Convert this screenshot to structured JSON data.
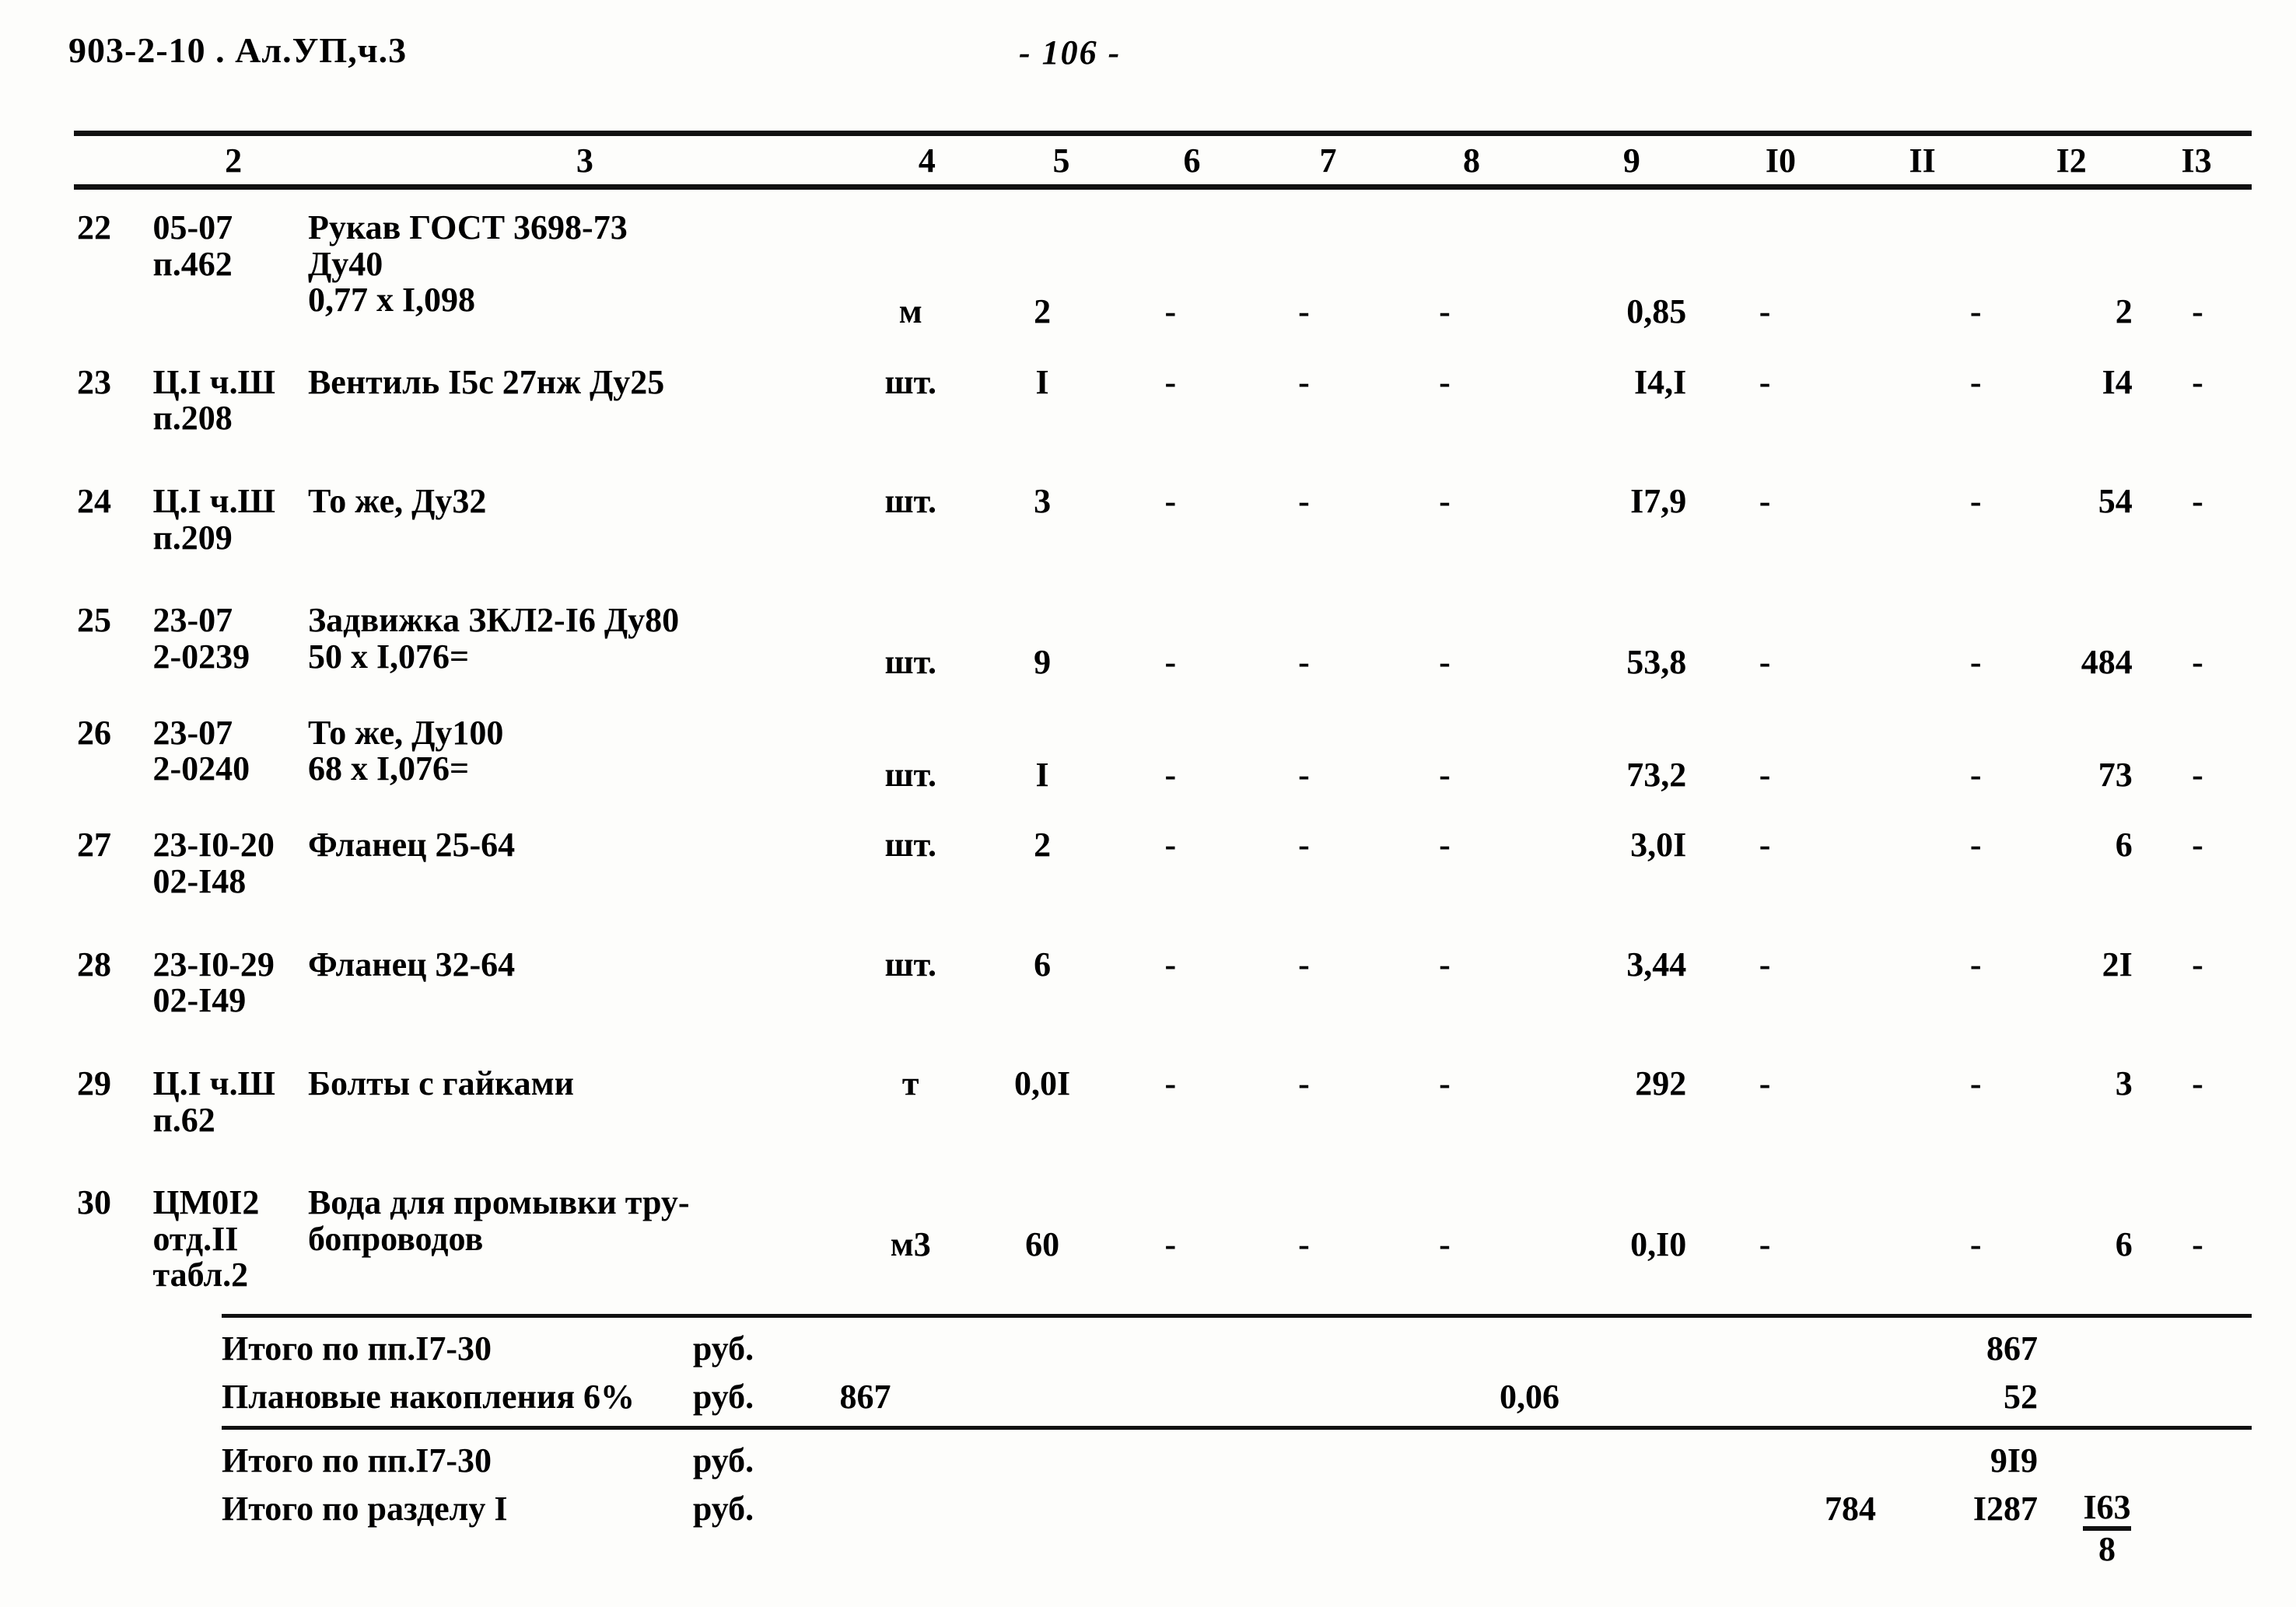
{
  "header": {
    "doc_code": "903-2-10  . Ал.УП,ч.3",
    "page_number": "- 106 -"
  },
  "table": {
    "columns": [
      "2",
      "3",
      "4",
      "5",
      "6",
      "7",
      "8",
      "9",
      "I0",
      "II",
      "I2",
      "I3"
    ],
    "rows": [
      {
        "no": "22",
        "code": "05-07\nп.462",
        "name": "Рукав ГОСТ 3698-73\nДу40\n0,77 х I,098",
        "unit": "м",
        "qty": "2",
        "c6": "-",
        "c7": "-",
        "c8": "-",
        "c9": "0,85",
        "c10": "-",
        "c11": "-",
        "c12": "2",
        "c13": "-"
      },
      {
        "no": "23",
        "code": "Ц.I ч.Ш\nп.208",
        "name": "Вентиль I5с 27нж Ду25",
        "unit": "шт.",
        "qty": "I",
        "c6": "-",
        "c7": "-",
        "c8": "-",
        "c9": "I4,I",
        "c10": "-",
        "c11": "-",
        "c12": "I4",
        "c13": "-"
      },
      {
        "no": "24",
        "code": "Ц.I ч.Ш\nп.209",
        "name": "То же, Ду32",
        "unit": "шт.",
        "qty": "3",
        "c6": "-",
        "c7": "-",
        "c8": "-",
        "c9": "I7,9",
        "c10": "-",
        "c11": "-",
        "c12": "54",
        "c13": "-"
      },
      {
        "no": "25",
        "code": "23-07\n2-0239",
        "name": "Задвижка ЗКЛ2-I6 Ду80\n50 х I,076=",
        "unit": "шт.",
        "qty": "9",
        "c6": "-",
        "c7": "-",
        "c8": "-",
        "c9": "53,8",
        "c10": "-",
        "c11": "-",
        "c12": "484",
        "c13": "-"
      },
      {
        "no": "26",
        "code": "23-07\n2-0240",
        "name": "То же, Ду100\n68 х I,076=",
        "unit": "шт.",
        "qty": "I",
        "c6": "-",
        "c7": "-",
        "c8": "-",
        "c9": "73,2",
        "c10": "-",
        "c11": "-",
        "c12": "73",
        "c13": "-"
      },
      {
        "no": "27",
        "code": "23-I0-20\n02-I48",
        "name": "Фланец 25-64",
        "unit": "шт.",
        "qty": "2",
        "c6": "-",
        "c7": "-",
        "c8": "-",
        "c9": "3,0I",
        "c10": "-",
        "c11": "-",
        "c12": "6",
        "c13": "-"
      },
      {
        "no": "28",
        "code": "23-I0-29\n02-I49",
        "name": "Фланец 32-64",
        "unit": "шт.",
        "qty": "6",
        "c6": "-",
        "c7": "-",
        "c8": "-",
        "c9": "3,44",
        "c10": "-",
        "c11": "-",
        "c12": "2I",
        "c13": "-"
      },
      {
        "no": "29",
        "code": "Ц.I ч.Ш\nп.62",
        "name": "Болты с гайками",
        "unit": "т",
        "qty": "0,0I",
        "c6": "-",
        "c7": "-",
        "c8": "-",
        "c9": "292",
        "c10": "-",
        "c11": "-",
        "c12": "3",
        "c13": "-"
      },
      {
        "no": "30",
        "code": "ЦМ0I2\nотд.II\nтабл.2",
        "name": "Вода для промывки тру-\nбопроводов",
        "unit": "м3",
        "qty": "60",
        "c6": "-",
        "c7": "-",
        "c8": "-",
        "c9": "0,I0",
        "c10": "-",
        "c11": "-",
        "c12": "6",
        "c13": "-"
      }
    ],
    "summary_top": [
      {
        "label": "Итого по пп.I7-30",
        "unit": "руб.",
        "qty": "",
        "c9": "",
        "c11": "",
        "c12": "867",
        "c13": ""
      },
      {
        "label": "Плановые накопления 6%",
        "unit": "руб.",
        "qty": "867",
        "c9": "0,06",
        "c11": "",
        "c12": "52",
        "c13": ""
      }
    ],
    "summary_bottom": [
      {
        "label": "Итого по пп.I7-30",
        "unit": "руб.",
        "qty": "",
        "c9": "",
        "c11": "",
        "c12": "9I9",
        "c13": ""
      },
      {
        "label": "Итого по разделу I",
        "unit": "руб.",
        "qty": "",
        "c9": "",
        "c11": "784",
        "c12": "I287",
        "c13_fraction": {
          "numerator": "I63",
          "denominator": "8"
        }
      }
    ]
  }
}
